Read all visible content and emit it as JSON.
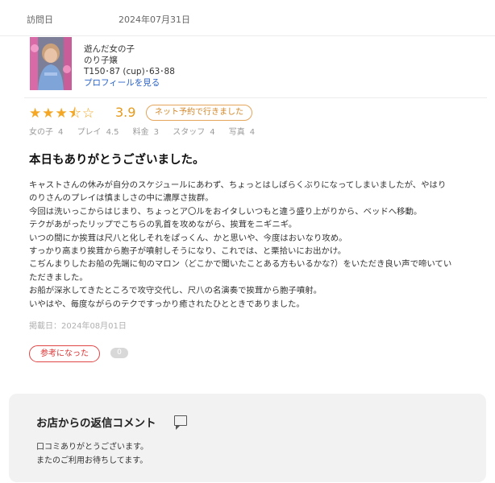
{
  "visit": {
    "label": "訪問日",
    "date": "2024年07月31日"
  },
  "cast": {
    "line1": "遊んだ女の子",
    "name": "のり子嬢",
    "stats": "T150･87 (cup)･63･88",
    "profile_link": "プロフィールを見る"
  },
  "rating": {
    "stars": 3.5,
    "score": "3.9",
    "badge": "ネット予約で行きました",
    "colors": {
      "star": "#f5a623",
      "score": "#e59a1b",
      "badge": "#d4872a"
    }
  },
  "subscores": [
    {
      "label": "女の子",
      "value": "4"
    },
    {
      "label": "プレイ",
      "value": "4.5"
    },
    {
      "label": "料金",
      "value": "3"
    },
    {
      "label": "スタッフ",
      "value": "4"
    },
    {
      "label": "写真",
      "value": "4"
    }
  ],
  "review": {
    "title": "本日もありがとうございました。",
    "lines": [
      "キャストさんの休みが自分のスケジュールにあわず、ちょっとはしばらくぶりになってしまいましたが、やはり",
      "のりさんのプレイは慎ましさの中に濃厚さ抜群。",
      "今回は洗いっこからはじまり、ちょっとア〇ルをおイタしいつもと違う盛り上がりから、ベッドへ移動。",
      "テクがあがったリップでこちらの乳首を攻めながら、挨茸をニギニギ。",
      "いつの間にか挨茸は尺八と化しそれをぱっくん、かと思いや、今度はおいなり攻め。",
      "すっかり高まり挨茸から胞子が噴射しそうになり、これでは、と栗拾いにお出かけ。",
      "こぢんまりしたお船の先端に旬のマロン（どこかで聞いたことある方もいるかな?）をいただき良い声で啼いてい",
      "ただきました。",
      "お船が深氷してきたところで攻守交代し、尺八の名演奏で挨茸から胞子噴射。",
      "いやはや、毎度ながらのテクですっかり癒されたひとときでありました。"
    ],
    "posted": "掲載日：2024年08月01日"
  },
  "helpful": {
    "label": "参考になった",
    "count": "0",
    "color": "#e04646"
  },
  "reply": {
    "title": "お店からの返信コメント",
    "icon": "comment-icon",
    "lines": [
      "口コミありがとうございます。",
      "またのご利用お待ちしてます。"
    ]
  }
}
